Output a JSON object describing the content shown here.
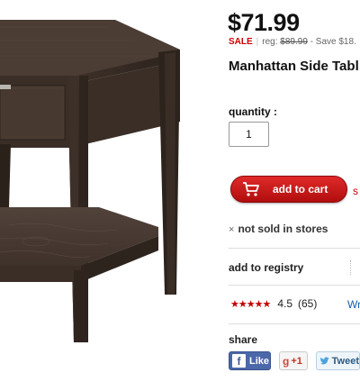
{
  "product": {
    "price": "$71.99",
    "sale_label": "SALE",
    "reg_prefix": "reg:",
    "reg_price": "$89.99",
    "save_text": "- Save $18.",
    "title": "Manhattan Side Tabl"
  },
  "quantity": {
    "label": "quantity :",
    "value": "1"
  },
  "cart": {
    "button_label": "add to cart",
    "side_link": "s"
  },
  "availability": {
    "x_mark": "×",
    "text": "not sold in stores"
  },
  "registry": {
    "label": "add to registry"
  },
  "rating": {
    "stars": "★★★★★",
    "value": "4.5",
    "count": "(65)",
    "write_link": "Wr"
  },
  "share": {
    "label": "share",
    "facebook_icon": "f",
    "facebook_label": "Like",
    "google_icon": "g",
    "google_label": "+1",
    "twitter_label": "Tweet"
  },
  "colors": {
    "sale_red": "#cc0000",
    "cart_red": "#c41818",
    "link_blue": "#1a5dab",
    "facebook_blue": "#4b68a8"
  },
  "icons": [
    "cart-icon",
    "close-x-icon",
    "facebook-icon",
    "google-plus-icon",
    "twitter-bird-icon",
    "star-icon"
  ]
}
